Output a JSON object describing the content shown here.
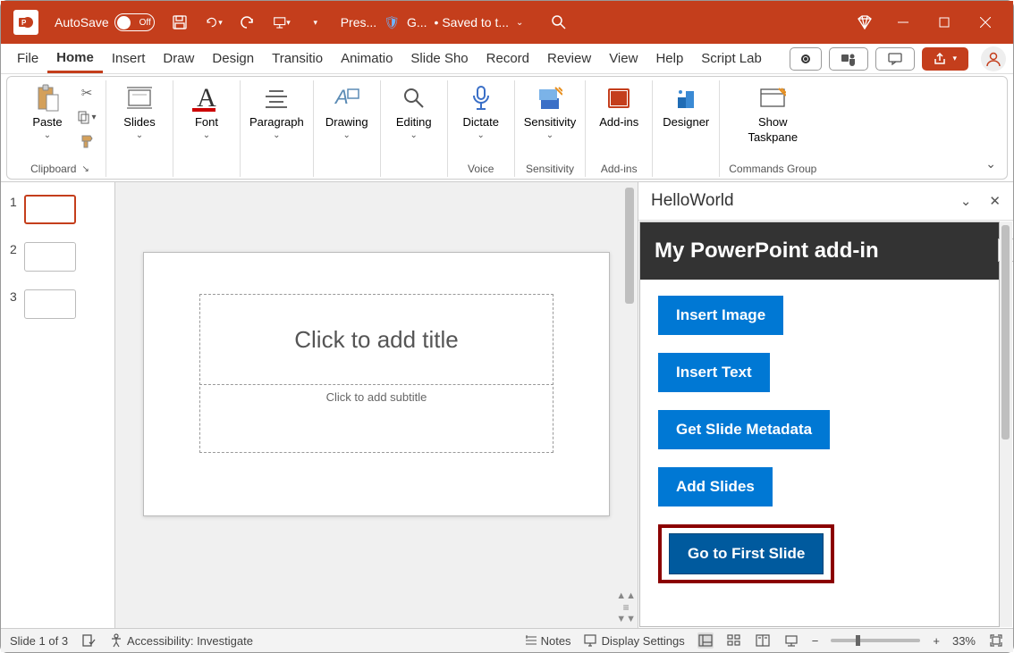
{
  "titlebar": {
    "autosave_label": "AutoSave",
    "toggle_state": "Off",
    "doc_name_short": "Pres...",
    "status_saved": "• Saved to t...",
    "status_g": "G..."
  },
  "tabs": {
    "file": "File",
    "home": "Home",
    "insert": "Insert",
    "draw": "Draw",
    "design": "Design",
    "transitions": "Transitio",
    "animation": "Animatio",
    "slideshow": "Slide Sho",
    "record": "Record",
    "review": "Review",
    "view": "View",
    "help": "Help",
    "scriptlab": "Script Lab"
  },
  "ribbon": {
    "clipboard": {
      "paste": "Paste",
      "label": "Clipboard"
    },
    "slides": {
      "btn": "Slides"
    },
    "font": {
      "btn": "Font"
    },
    "paragraph": {
      "btn": "Paragraph"
    },
    "drawing": {
      "btn": "Drawing"
    },
    "editing": {
      "btn": "Editing"
    },
    "dictate": {
      "btn": "Dictate",
      "label": "Voice"
    },
    "sensitivity": {
      "btn": "Sensitivity",
      "label": "Sensitivity"
    },
    "addins": {
      "btn": "Add-ins",
      "label": "Add-ins"
    },
    "designer": {
      "btn": "Designer"
    },
    "taskpane": {
      "btn1": "Show",
      "btn2": "Taskpane",
      "label": "Commands Group"
    }
  },
  "thumbs": [
    {
      "num": "1",
      "selected": true
    },
    {
      "num": "2",
      "selected": false
    },
    {
      "num": "3",
      "selected": false
    }
  ],
  "slide": {
    "title_placeholder": "Click to add title",
    "subtitle_placeholder": "Click to add subtitle"
  },
  "taskpane": {
    "title": "HelloWorld",
    "banner": "My PowerPoint add-in",
    "buttons": {
      "insert_image": "Insert Image",
      "insert_text": "Insert Text",
      "get_metadata": "Get Slide Metadata",
      "add_slides": "Add Slides",
      "go_first": "Go to First Slide"
    }
  },
  "statusbar": {
    "slide_count": "Slide 1 of 3",
    "accessibility": "Accessibility: Investigate",
    "notes": "Notes",
    "display": "Display Settings",
    "zoom": "33%"
  }
}
